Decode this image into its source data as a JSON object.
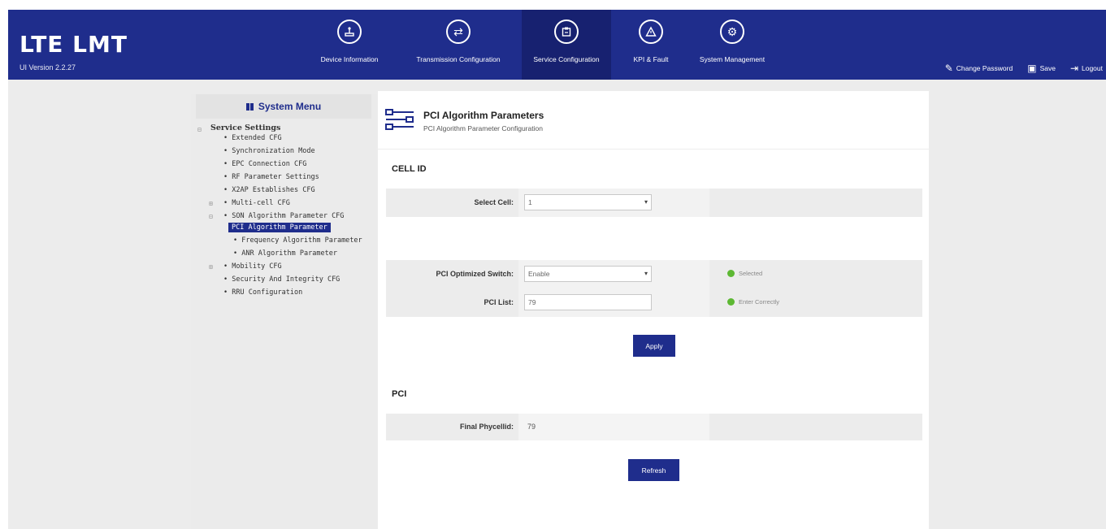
{
  "app": {
    "title": "LTE  LMT",
    "version": "UI Version 2.2.27"
  },
  "nav": [
    {
      "label": "Device Information",
      "icon": "device-icon"
    },
    {
      "label": "Transmission Configuration",
      "icon": "transfer-icon"
    },
    {
      "label": "Service Configuration",
      "icon": "clipboard-icon",
      "active": true
    },
    {
      "label": "KPI & Fault",
      "icon": "warning-icon"
    },
    {
      "label": "System Management",
      "icon": "gear-icon"
    }
  ],
  "header_actions": {
    "change_password": "Change Password",
    "save": "Save",
    "logout": "Logout"
  },
  "sidebar": {
    "title": "System Menu",
    "root": "Service Settings",
    "items": [
      "Extended CFG",
      "Synchronization Mode",
      "EPC Connection CFG",
      "RF Parameter Settings",
      "X2AP Establishes CFG",
      "Multi-cell CFG",
      "SON Algorithm Parameter CFG",
      "Mobility CFG",
      "Security And Integrity CFG",
      "RRU Configuration"
    ],
    "son_children": [
      "PCI Algorithm Parameter",
      "Frequency Algorithm Parameter",
      "ANR Algorithm Parameter"
    ]
  },
  "page": {
    "title": "PCI Algorithm Parameters",
    "subtitle": "PCI Algorithm Parameter Configuration"
  },
  "cell_id": {
    "section": "CELL ID",
    "select_cell_label": "Select Cell:",
    "select_cell_value": "1"
  },
  "pci_cfg": {
    "switch_label": "PCI Optimized Switch:",
    "switch_value": "Enable",
    "switch_hint": "Selected",
    "list_label": "PCI List:",
    "list_value": "79",
    "list_hint": "Enter Correctly",
    "apply_label": "Apply"
  },
  "pci": {
    "section": "PCI",
    "final_label": "Final Phycellid:",
    "final_value": "79",
    "refresh_label": "Refresh"
  },
  "colors": {
    "header_bg": "#1f2d8c",
    "active_nav": "#172170",
    "button": "#1f2d8c",
    "hint_ok": "#5db833"
  }
}
